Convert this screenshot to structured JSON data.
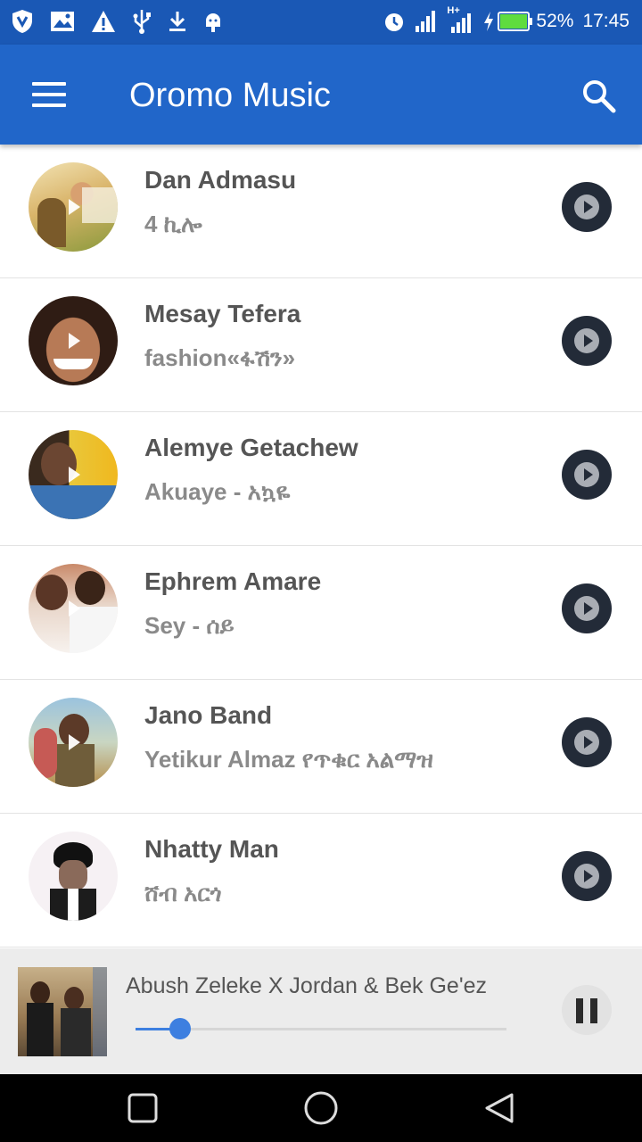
{
  "status_bar": {
    "battery": "52%",
    "time": "17:45",
    "network_label": "H+"
  },
  "app_bar": {
    "title": "Oromo Music",
    "menu_icon": "hamburger-menu-icon",
    "search_icon": "search-icon"
  },
  "songs": [
    {
      "artist": "Dan Admasu",
      "title": "4 ኪሎ"
    },
    {
      "artist": "Mesay Tefera",
      "title": "fashion«ፋሽን»"
    },
    {
      "artist": "Alemye Getachew",
      "title": "Akuaye - አኳዬ"
    },
    {
      "artist": "Ephrem Amare",
      "title": "Sey - ሰይ"
    },
    {
      "artist": "Jano Band",
      "title": "Yetikur Almaz የጥቁር አልማዝ"
    },
    {
      "artist": "Nhatty Man",
      "title": " ሸብ አርጎ"
    }
  ],
  "now_playing": {
    "title": "Abush Zeleke X Jordan & Bek Ge'ez",
    "progress": 0.12,
    "state_icon": "pause-icon"
  },
  "colors": {
    "status_bar": "#1a58b5",
    "app_bar": "#2166c9",
    "accent": "#3d7fe0",
    "play_button": "#232b38"
  }
}
